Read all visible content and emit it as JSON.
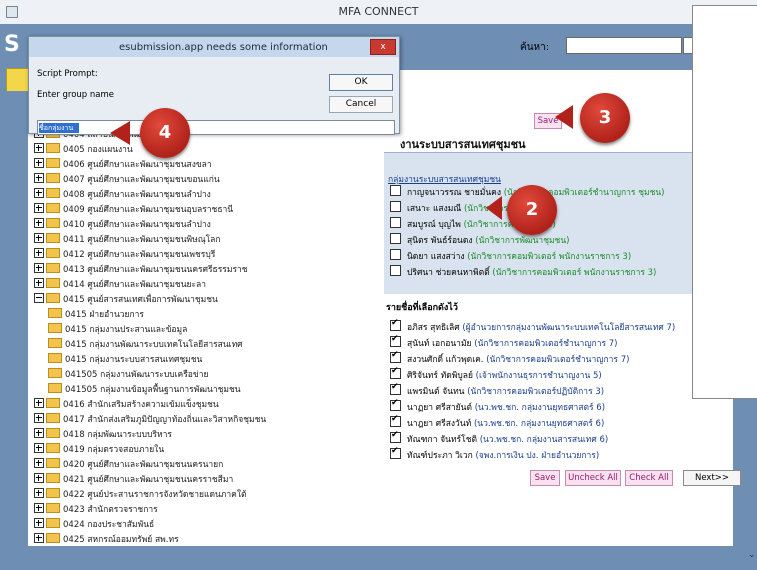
{
  "window": {
    "title": "MFA CONNECT"
  },
  "header": {
    "logo": "S",
    "search_label": "ค้นหา:",
    "search_value": ""
  },
  "tree": [
    {
      "t": "plus",
      "label": "0404 สถาบันการพัฒนาชุมชน"
    },
    {
      "t": "plus",
      "label": "0405 กองแผนงาน"
    },
    {
      "t": "plus",
      "label": "0406 ศูนย์ศึกษาและพัฒนาชุมชนสงขลา"
    },
    {
      "t": "plus",
      "label": "0407 ศูนย์ศึกษาและพัฒนาชุมชนขอนแก่น"
    },
    {
      "t": "plus",
      "label": "0408 ศูนย์ศึกษาและพัฒนาชุมชนลำปาง"
    },
    {
      "t": "plus",
      "label": "0409 ศูนย์ศึกษาและพัฒนาชุมชนอุบลราชธานี"
    },
    {
      "t": "plus",
      "label": "0410 ศูนย์ศึกษาและพัฒนาชุมชนลำปาง"
    },
    {
      "t": "plus",
      "label": "0411 ศูนย์ศึกษาและพัฒนาชุมชนพิษณุโลก"
    },
    {
      "t": "plus",
      "label": "0412 ศูนย์ศึกษาและพัฒนาชุมชนเพชรบุรี"
    },
    {
      "t": "plus",
      "label": "0413 ศูนย์ศึกษาและพัฒนาชุมชนนครศรีธรรมราช"
    },
    {
      "t": "plus",
      "label": "0414 ศูนย์ศึกษาและพัฒนาชุมชนยะลา"
    },
    {
      "t": "minus",
      "label": "0415 ศูนย์สารสนเทศเพื่อการพัฒนาชุมชน"
    },
    {
      "t": "child",
      "label": "0415 ฝ่ายอำนวยการ"
    },
    {
      "t": "child",
      "label": "0415 กลุ่มงานประสานและข้อมูล"
    },
    {
      "t": "child",
      "label": "0415 กลุ่มงานพัฒนาระบบเทคโนโลยีสารสนเทศ"
    },
    {
      "t": "child",
      "label": "0415 กลุ่มงานระบบสารสนเทศชุมชน"
    },
    {
      "t": "child",
      "label": "041505 กลุ่มงานพัฒนาระบบเครือข่าย"
    },
    {
      "t": "child",
      "label": "041505 กลุ่มงานข้อมูลพื้นฐานการพัฒนาชุมชน"
    },
    {
      "t": "plus",
      "label": "0416 สำนักเสริมสร้างความเข้มแข็งชุมชน"
    },
    {
      "t": "plus",
      "label": "0417 สำนักส่งเสริมภูมิปัญญาท้องถิ่นและวิสาหกิจชุมชน"
    },
    {
      "t": "plus",
      "label": "0418 กลุ่มพัฒนาระบบบริหาร"
    },
    {
      "t": "plus",
      "label": "0419 กลุ่มตรวจสอบภายใน"
    },
    {
      "t": "plus",
      "label": "0420 ศูนย์ศึกษาและพัฒนาชุมชนนครนายก"
    },
    {
      "t": "plus",
      "label": "0421 ศูนย์ศึกษาและพัฒนาชุมชนนครราชสีมา"
    },
    {
      "t": "plus",
      "label": "0422 ศูนย์ประสานราชการจังหวัดชายแดนภาคใต้"
    },
    {
      "t": "plus",
      "label": "0423 สำนักตรวจราชการ"
    },
    {
      "t": "plus",
      "label": "0424 กองประชาสัมพันธ์"
    },
    {
      "t": "plus",
      "label": "0425 สหกรณ์ออมทรัพย์ สพ.ทร"
    }
  ],
  "panel": {
    "title": "งานระบบสารสนเทศชุมชน",
    "subtitle": "กลุ่มงานระบบสารสนเทศชุมชน",
    "members": [
      {
        "name": "กาญจนาวรรณ ชายมั่นคง",
        "role": "(นักวิชาการคอมพิวเตอร์ชำนาญการ ชุมชน)"
      },
      {
        "name": "เสนาะ แสงมณี",
        "role": "(นักวิชาการคอมพิวเตอร์)"
      },
      {
        "name": "สมบูรณ์ บุญไพ",
        "role": "(นักวิชาการคอมพิวเตอร์)"
      },
      {
        "name": "สุนิตร พันธ์ร์อนดง",
        "role": "(นักวิชาการพัฒนาชุมชน)"
      },
      {
        "name": "นิดยา แสงสว่าง",
        "role": "(นักวิชาการคอมพิวเตอร์ พนักงานราชการ 3)"
      },
      {
        "name": "ปริศนา ช่วยคนหาพิตติ์",
        "role": "(นักวิชาการคอมพิวเตอร์ พนักงานราชการ 3)"
      }
    ],
    "selected_title": "รายชื่อที่เลือกดังไว้",
    "selected": [
      {
        "name": "อภิสร สุทธิเลิศ",
        "role": "(ผู้อำนวยการกลุ่มงานพัฒนาระบบเทคโนโลยีสารสนเทศ 7)"
      },
      {
        "name": "สุนันท์ เอกอนามัย",
        "role": "(นักวิชาการคอมพิวเตอร์ชำนาญการ 7)"
      },
      {
        "name": "สงวนศักดิ์ แก้วพุดเค.",
        "role": "(นักวิชาการคอมพิวเตอร์ชำนาญการ 7)"
      },
      {
        "name": "ศิริจันทร์ ทัดพิบูลย์",
        "role": "(เจ้าพนักงานธุรการชำนาญงาน 5)"
      },
      {
        "name": "แพรมินต์ จันทน",
        "role": "(นักวิชาการคอมพิวเตอร์ปฏิบัติการ 3)"
      },
      {
        "name": "นาฏยา ศรีสายันต์",
        "role": "(นว.พช.ชก. กลุ่มงานยุทธศาสตร์ 6)"
      },
      {
        "name": "นาฎยา ศรีสงวันท์",
        "role": "(นว.พช.ชก. กลุ่มงานยุทธศาสตร์ 6)"
      },
      {
        "name": "ทัณฑกา จันทร์โชติ",
        "role": "(นว.พช.ชก. กลุ่มงานสารสนเทศ 6)"
      },
      {
        "name": "ทัณฑ์ประภา วิเวก",
        "role": "(จพง.การเงิน ปง. ฝ่ายอำนวยการ)"
      }
    ],
    "buttons": {
      "save": "Save",
      "uncheck_all": "Uncheck All",
      "check_all": "Check All",
      "next": "Next>>"
    }
  },
  "dialog": {
    "title": "esubmission.app needs some information",
    "close": "x",
    "script_prompt": "Script Prompt:",
    "enter_group": "Enter group name",
    "ok": "OK",
    "cancel": "Cancel",
    "input_value": "ชื่อกลุ่มงาน"
  },
  "badges": {
    "b2": "2",
    "b3": "3",
    "b4": "4"
  },
  "colors": {
    "accent": "#6e8fb3",
    "badge": "#c8322a",
    "green_text": "#1b8a2a"
  }
}
